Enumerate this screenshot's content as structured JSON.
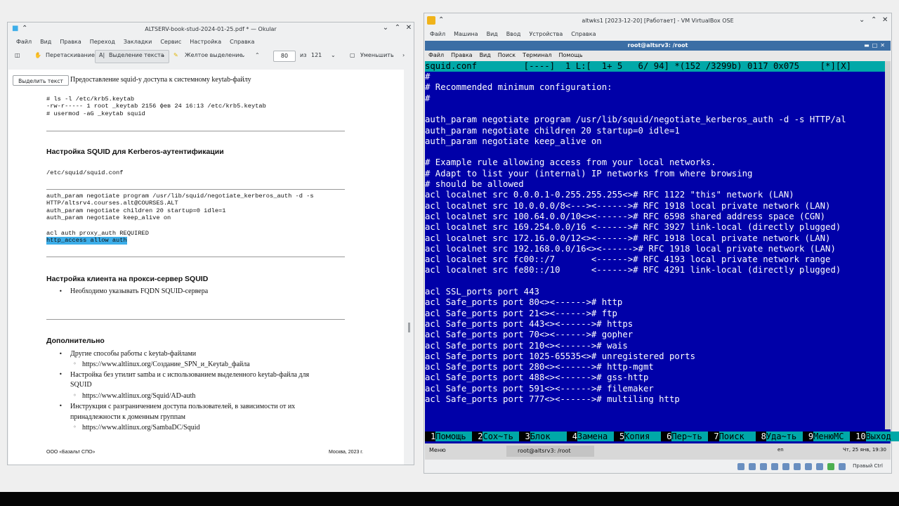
{
  "okular": {
    "title": "ALTSERV-book-stud-2024-01-25.pdf * — Okular",
    "menu": [
      "Файл",
      "Вид",
      "Правка",
      "Переход",
      "Закладки",
      "Сервис",
      "Настройка",
      "Справка"
    ],
    "toolbar": {
      "pan": "Перетаскивание",
      "text_select": "Выделение текста",
      "yellow_highlight": "Желтое выделение",
      "page_current": "80",
      "page_of": "из",
      "page_total": "121",
      "zoom_out": "Уменьшить"
    },
    "select_text_button": "Выделить текст",
    "page": {
      "intro": "Предоставление squid-у доступа к системному keytab-файлу",
      "code1": [
        "# ls -l /etc/krb5.keytab",
        "-rw-r----- 1 root _keytab 2156 фев 24 16:13 /etc/krb5.keytab",
        "# usermod -aG _keytab squid"
      ],
      "h1": "Настройка SQUID для Kerberos-аутентификации",
      "path": "/etc/squid/squid.conf",
      "code2": [
        "auth_param negotiate program /usr/lib/squid/negotiate_kerberos_auth -d -s",
        "HTTP/altsrv4.courses.alt@COURSES.ALT",
        "auth_param negotiate children 20 startup=0 idle=1",
        "auth_param negotiate keep_alive on",
        "",
        "acl auth proxy_auth REQUIRED"
      ],
      "code2_highlight": "http_access allow auth",
      "h2": "Настройка клиента на прокси-сервер SQUID",
      "bullet1": "Необходимо указывать FQDN SQUID-сервера",
      "h3": "Дополнительно",
      "extra": [
        {
          "text": "Другие способы работы с keytab-файлами",
          "sub": "https://www.altlinux.org/Создание_SPN_и_Keytab_файла"
        },
        {
          "text": "Настройка без утилит samba и с использованием выделенного keytab-файла для",
          "text2": "SQUID",
          "sub": "https://www.altlinux.org/Squid/AD-auth"
        },
        {
          "text": "Инструкция с разграничением доступа пользователей, в зависимости от их",
          "text2": "принадлежности к доменным группам",
          "sub": "https://www.altlinux.org/SambaDC/Squid"
        }
      ],
      "footer_left": "ООО «Базальт СПО»",
      "footer_right": "Москва, 2023 г."
    }
  },
  "vbox": {
    "title": "altwks1 [2023-12-20] [Работает] - VM VirtualBox OSE",
    "menu": [
      "Файл",
      "Машина",
      "Вид",
      "Ввод",
      "Устройства",
      "Справка"
    ],
    "host_key": "Правый Ctrl",
    "terminal": {
      "title": "root@altsrv3: /root",
      "menu": [
        "Файл",
        "Правка",
        "Вид",
        "Поиск",
        "Терминал",
        "Помощь"
      ],
      "status": "squid.conf         [----]  1 L:[  1+ 5   6/ 94] *(152 /3299b) 0117 0x075    [*][X]",
      "lines": [
        "#",
        "# Recommended minimum configuration:",
        "#",
        "",
        "auth_param negotiate program /usr/lib/squid/negotiate_kerberos_auth -d -s HTTP/al",
        "auth_param negotiate children 20 startup=0 idle=1",
        "auth_param negotiate keep_alive on",
        "",
        "# Example rule allowing access from your local networks.",
        "# Adapt to list your (internal) IP networks from where browsing",
        "# should be allowed",
        "acl localnet src 0.0.0.1-0.255.255.255<># RFC 1122 \"this\" network (LAN)",
        "acl localnet src 10.0.0.0/8<---><------># RFC 1918 local private network (LAN)",
        "acl localnet src 100.64.0.0/10<><------># RFC 6598 shared address space (CGN)",
        "acl localnet src 169.254.0.0/16 <------># RFC 3927 link-local (directly plugged)",
        "acl localnet src 172.16.0.0/12<><------># RFC 1918 local private network (LAN)",
        "acl localnet src 192.168.0.0/16<><------># RFC 1918 local private network (LAN)",
        "acl localnet src fc00::/7       <------># RFC 4193 local private network range",
        "acl localnet src fe80::/10      <------># RFC 4291 link-local (directly plugged)",
        "",
        "acl SSL_ports port 443",
        "acl Safe_ports port 80<><------># http",
        "acl Safe_ports port 21<><------># ftp",
        "acl Safe_ports port 443<><------># https",
        "acl Safe_ports port 70<><------># gopher",
        "acl Safe_ports port 210<><------># wais",
        "acl Safe_ports port 1025-65535<># unregistered ports",
        "acl Safe_ports port 280<><------># http-mgmt",
        "acl Safe_ports port 488<><------># gss-http",
        "acl Safe_ports port 591<><------># filemaker",
        "acl Safe_ports port 777<><------># multiling http"
      ],
      "fkeys": [
        {
          "n": "1",
          "l": "Помощь"
        },
        {
          "n": "2",
          "l": "Сох~ть"
        },
        {
          "n": "3",
          "l": "Блок"
        },
        {
          "n": "4",
          "l": "Замена"
        },
        {
          "n": "5",
          "l": "Копия"
        },
        {
          "n": "6",
          "l": "Пер~ть"
        },
        {
          "n": "7",
          "l": "Поиск"
        },
        {
          "n": "8",
          "l": "Уда~ть"
        },
        {
          "n": "9",
          "l": "МенюМС"
        },
        {
          "n": "10",
          "l": "Выход"
        }
      ]
    },
    "guest_taskbar": {
      "start": "Меню",
      "task": "root@altsrv3: /root",
      "lang": "en",
      "clock": "Чт, 25 янв, 19:30"
    }
  }
}
